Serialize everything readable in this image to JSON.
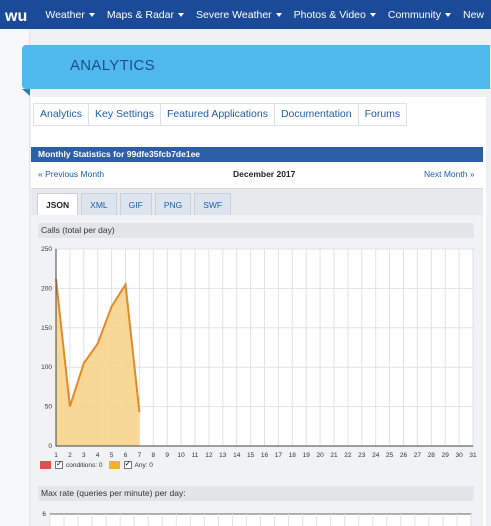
{
  "nav": {
    "items": [
      {
        "label": "Weather",
        "caret": true
      },
      {
        "label": "Maps & Radar",
        "caret": true
      },
      {
        "label": "Severe Weather",
        "caret": true
      },
      {
        "label": "Photos & Video",
        "caret": true
      },
      {
        "label": "Community",
        "caret": true
      },
      {
        "label": "New",
        "caret": false
      }
    ]
  },
  "banner": {
    "title": "ANALYTICS"
  },
  "subnav": [
    "Analytics",
    "Key Settings",
    "Featured Applications",
    "Documentation",
    "Forums"
  ],
  "stats": {
    "header": "Monthly Statistics for 99dfe35fcb7de1ee",
    "prev": "« Previous Month",
    "month": "December 2017",
    "next": "Next Month »"
  },
  "tabs": [
    {
      "label": "JSON",
      "active": true
    },
    {
      "label": "XML",
      "active": false
    },
    {
      "label": "GIF",
      "active": false
    },
    {
      "label": "PNG",
      "active": false
    },
    {
      "label": "SWF",
      "active": false
    }
  ],
  "chart1_title": "Calls (total per day)",
  "chart2_title": "Max rate (queries per minute) per day:",
  "legend": [
    {
      "color": "#d9534f",
      "label": "conditions: 0"
    },
    {
      "color": "#f0b429",
      "label": "Any: 0"
    }
  ],
  "chart_data": [
    {
      "type": "area",
      "title": "Calls (total per day)",
      "x": [
        1,
        2,
        3,
        4,
        5,
        6,
        7
      ],
      "series": [
        {
          "name": "conditions",
          "values": [
            0,
            0,
            0,
            0,
            0,
            0,
            0
          ],
          "color": "#d9534f"
        },
        {
          "name": "Any",
          "values": [
            212,
            50,
            105,
            130,
            177,
            205,
            43
          ],
          "color": "#f0b429"
        }
      ],
      "xticks": [
        1,
        2,
        3,
        4,
        5,
        6,
        7,
        8,
        9,
        10,
        11,
        12,
        13,
        14,
        15,
        16,
        17,
        18,
        19,
        20,
        21,
        22,
        23,
        24,
        25,
        26,
        27,
        28,
        29,
        30,
        31
      ],
      "yticks": [
        0,
        50,
        100,
        150,
        200,
        250
      ],
      "xlim": [
        1,
        31
      ],
      "ylim": [
        0,
        250
      ],
      "grid": true
    },
    {
      "type": "line",
      "title": "Max rate (queries per minute) per day:",
      "yticks": [
        6
      ],
      "grid": true
    }
  ]
}
